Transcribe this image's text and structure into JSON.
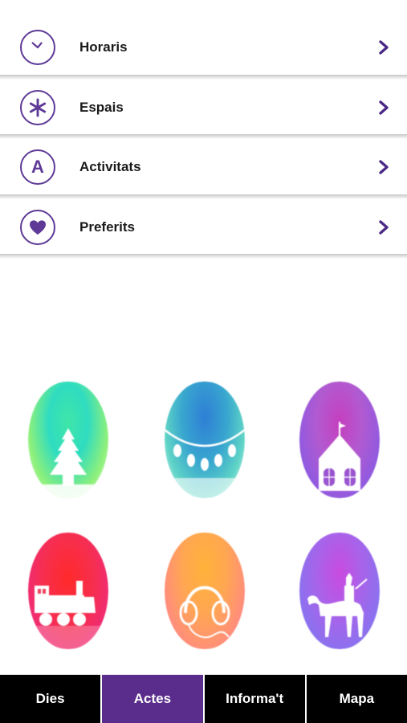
{
  "menu": {
    "items": [
      {
        "label": "Horaris",
        "icon": "clock-icon"
      },
      {
        "label": "Espais",
        "icon": "asterisk-icon"
      },
      {
        "label": "Activitats",
        "icon": "letter-a-icon",
        "icon_text": "A"
      },
      {
        "label": "Preferits",
        "icon": "heart-icon"
      }
    ]
  },
  "categories": [
    {
      "icon": "christmas-tree-icon",
      "colors": [
        "#2ee6b8",
        "#7df07a",
        "#b6f5ff"
      ]
    },
    {
      "icon": "garland-icon",
      "colors": [
        "#2f86d8",
        "#3bc0c8",
        "#9ff0e6"
      ]
    },
    {
      "icon": "house-icon",
      "colors": [
        "#c13fbd",
        "#8f5ae0",
        "#f0a3e6"
      ]
    },
    {
      "icon": "train-icon",
      "colors": [
        "#ff3b3b",
        "#f5276e",
        "#ff9aa8"
      ]
    },
    {
      "icon": "headphones-icon",
      "colors": [
        "#ffb43a",
        "#ff8a74",
        "#ffd9b0"
      ]
    },
    {
      "icon": "camel-rider-icon",
      "colors": [
        "#c94be0",
        "#8a72ef",
        "#e9b3ff"
      ]
    }
  ],
  "tabbar": {
    "tabs": [
      {
        "label": "Dies",
        "active": false
      },
      {
        "label": "Actes",
        "active": true
      },
      {
        "label": "Informa't",
        "active": false
      },
      {
        "label": "Mapa",
        "active": false
      }
    ]
  },
  "colors": {
    "accent": "#5e3a96",
    "active_tab": "#5a2d8c",
    "tabbar_bg": "#000000"
  }
}
